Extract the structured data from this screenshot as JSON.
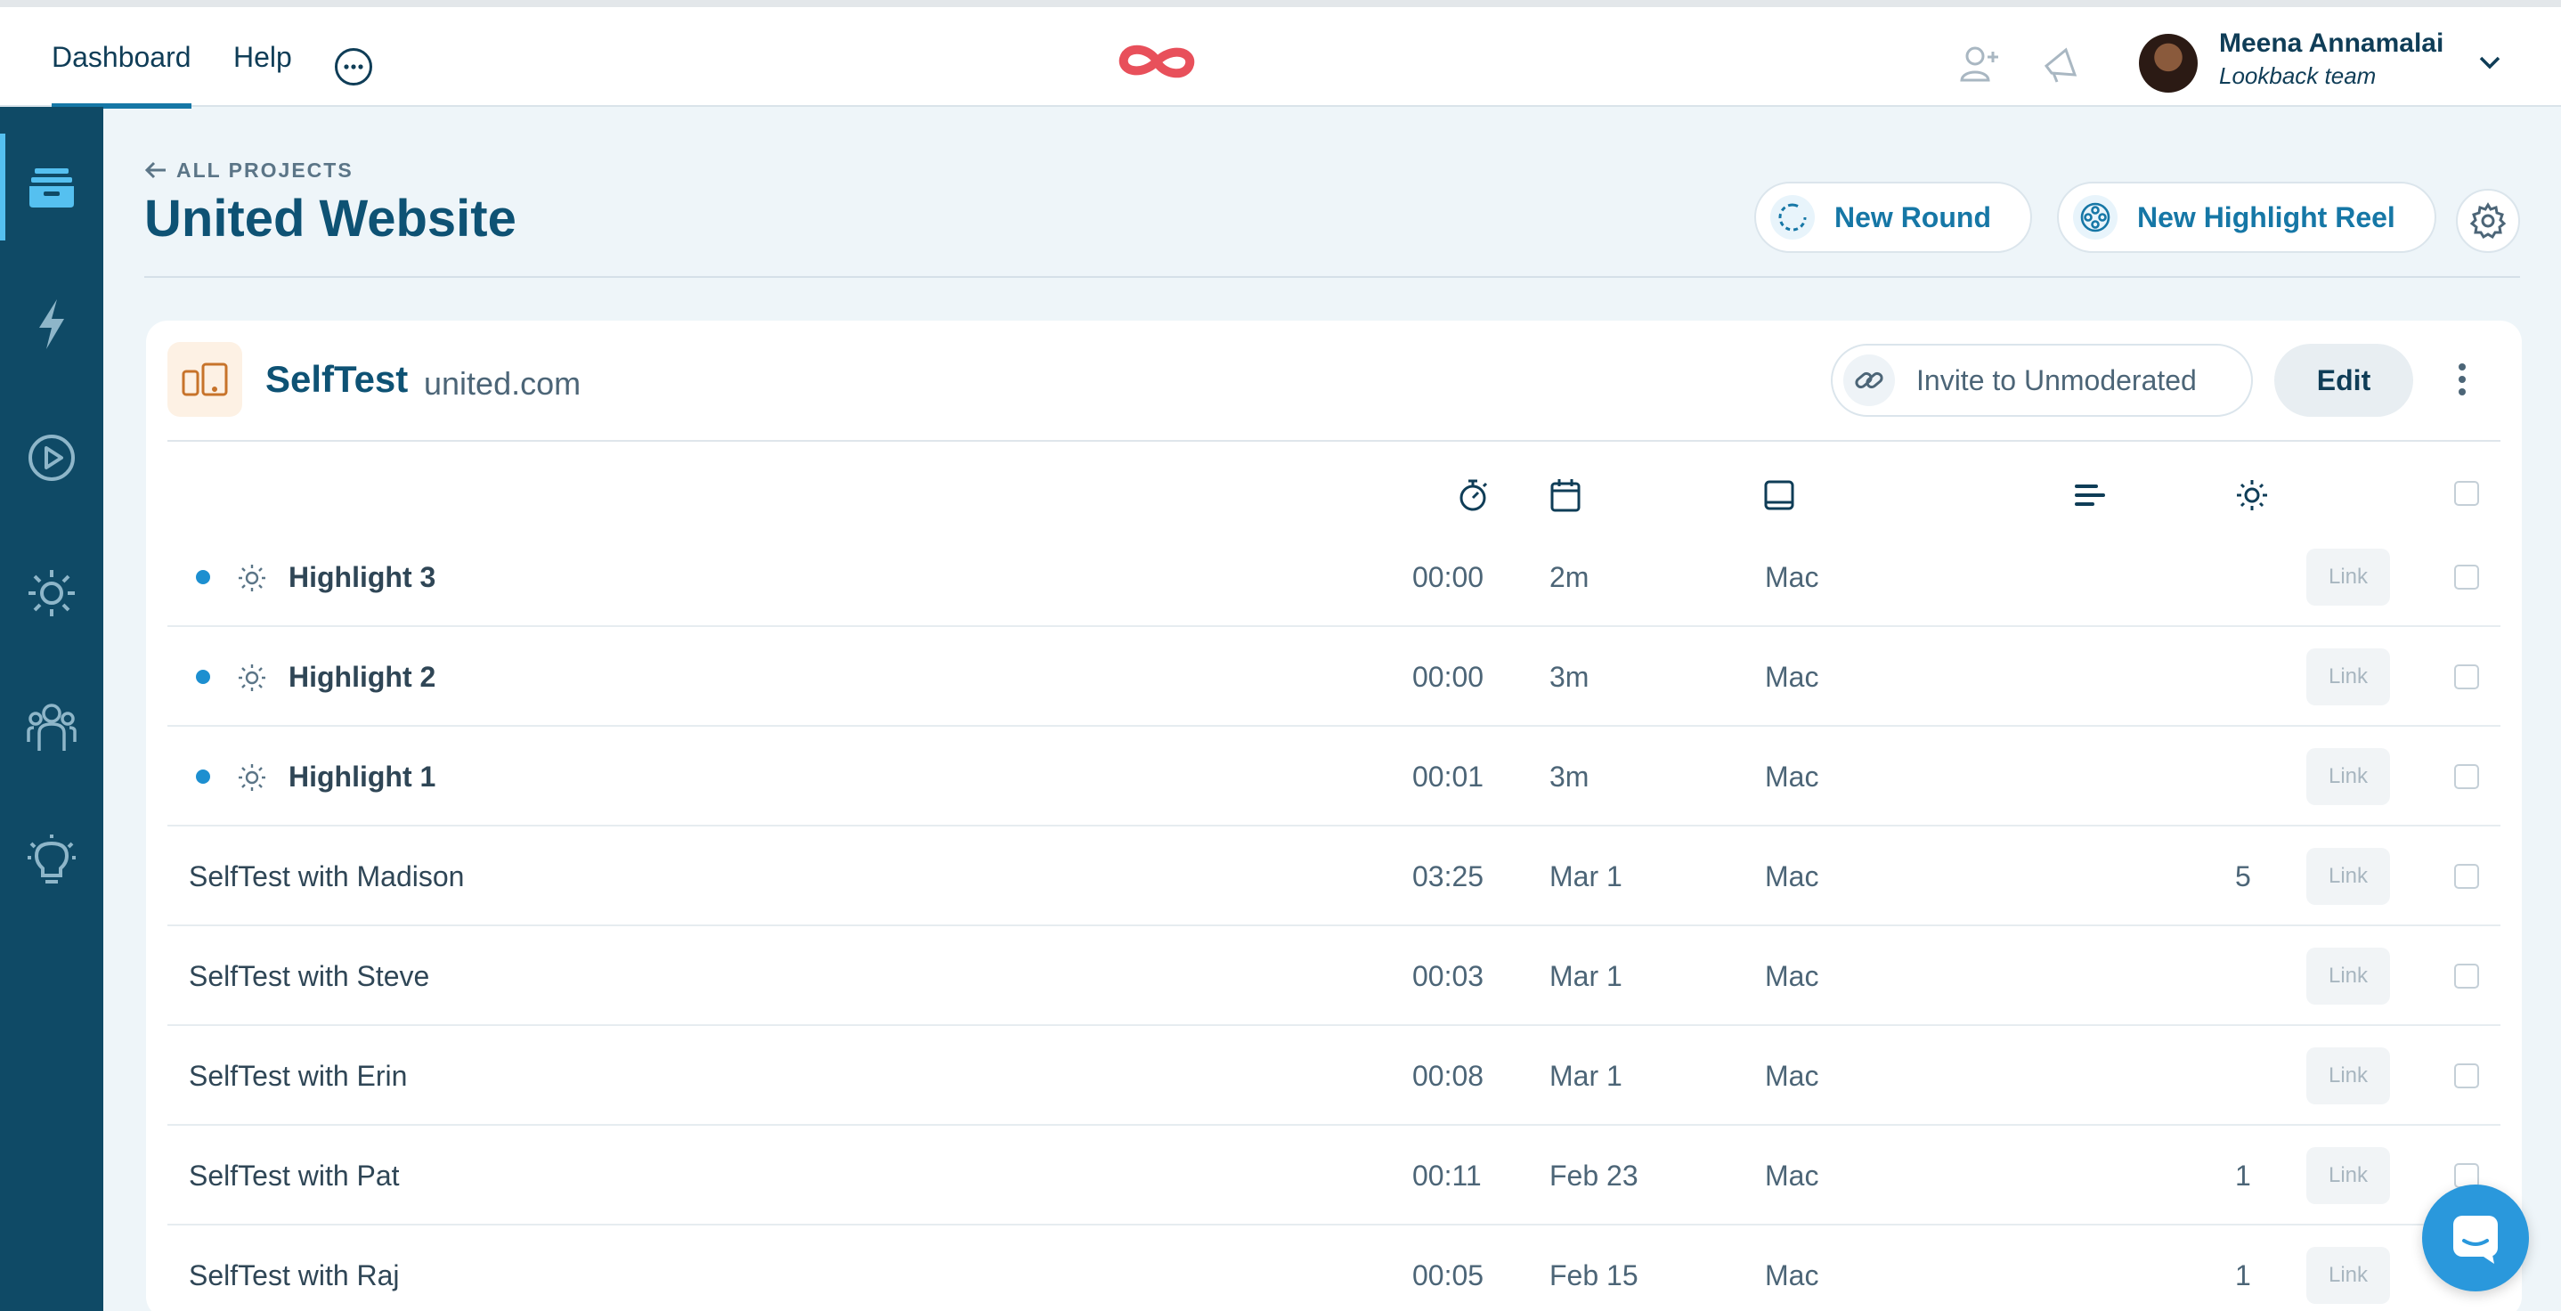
{
  "topnav": {
    "tabs": [
      {
        "label": "Dashboard",
        "active": true
      },
      {
        "label": "Help",
        "active": false
      }
    ],
    "more_icon": "ellipsis-circle-icon",
    "logo_icon": "infinity-logo-icon",
    "user": {
      "name": "Meena Annamalai",
      "team": "Lookback team"
    }
  },
  "sidebar": {
    "items": [
      {
        "icon": "projects-inbox-icon",
        "active": true
      },
      {
        "icon": "lightning-icon",
        "active": false
      },
      {
        "icon": "play-circle-icon",
        "active": false
      },
      {
        "icon": "sun-highlight-icon",
        "active": false
      },
      {
        "icon": "people-icon",
        "active": false
      },
      {
        "icon": "lightbulb-icon",
        "active": false
      }
    ]
  },
  "header": {
    "back_label": "ALL PROJECTS",
    "title": "United Website",
    "new_round_label": "New Round",
    "new_highlight_reel_label": "New Highlight Reel"
  },
  "project": {
    "name": "SelfTest",
    "domain": "united.com",
    "invite_label": "Invite to Unmoderated",
    "edit_label": "Edit",
    "columns": [
      "duration-stopwatch-icon",
      "date-calendar-icon",
      "device-icon",
      "notes-icon",
      "highlights-sun-icon"
    ],
    "rows": [
      {
        "name": "Highlight 3",
        "highlight": true,
        "duration": "00:00",
        "date": "2m",
        "device": "Mac",
        "count": "",
        "link": "Link"
      },
      {
        "name": "Highlight 2",
        "highlight": true,
        "duration": "00:00",
        "date": "3m",
        "device": "Mac",
        "count": "",
        "link": "Link"
      },
      {
        "name": "Highlight 1",
        "highlight": true,
        "duration": "00:01",
        "date": "3m",
        "device": "Mac",
        "count": "",
        "link": "Link"
      },
      {
        "name": "SelfTest with Madison",
        "highlight": false,
        "duration": "03:25",
        "date": "Mar 1",
        "device": "Mac",
        "count": "5",
        "link": "Link"
      },
      {
        "name": "SelfTest with Steve",
        "highlight": false,
        "duration": "00:03",
        "date": "Mar 1",
        "device": "Mac",
        "count": "",
        "link": "Link"
      },
      {
        "name": "SelfTest with Erin",
        "highlight": false,
        "duration": "00:08",
        "date": "Mar 1",
        "device": "Mac",
        "count": "",
        "link": "Link"
      },
      {
        "name": "SelfTest with Pat",
        "highlight": false,
        "duration": "00:11",
        "date": "Feb 23",
        "device": "Mac",
        "count": "1",
        "link": "Link"
      },
      {
        "name": "SelfTest with Raj",
        "highlight": false,
        "duration": "00:05",
        "date": "Feb 15",
        "device": "Mac",
        "count": "1",
        "link": "Link"
      }
    ]
  },
  "colors": {
    "sidebar_bg": "#0f4a66",
    "accent": "#1677a6",
    "logo": "#e8505b",
    "chat": "#2a98dc"
  }
}
